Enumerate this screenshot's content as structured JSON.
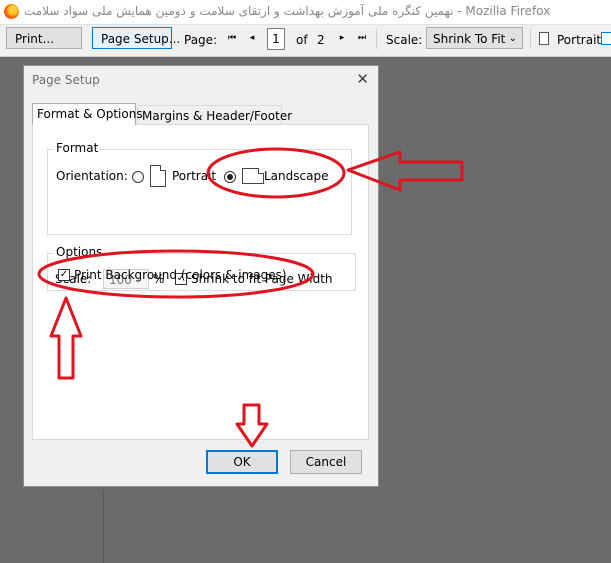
{
  "window": {
    "title": "نهمین کنگره ملی آموزش بهداشت و ارتقای سلامت و دومین همایش ملی سواد سلامت - Mozilla Firefox"
  },
  "toolbar": {
    "print_label": "Print...",
    "page_setup_label": "Page Setup...",
    "page_label": "Page:",
    "page_value": "1",
    "of_label": "of",
    "page_total": "2",
    "scale_label": "Scale:",
    "scale_value": "Shrink To Fit",
    "portrait_label": "Portrait",
    "first_page_icon": "⏮",
    "prev_page_icon": "◂",
    "next_page_icon": "▸",
    "last_page_icon": "⏭"
  },
  "dialog": {
    "title": "Page Setup",
    "tabs": [
      {
        "label": "Format & Options"
      },
      {
        "label": "Margins & Header/Footer"
      }
    ],
    "format": {
      "group_label": "Format",
      "orientation_label": "Orientation:",
      "portrait_label": "Portrait",
      "landscape_label": "Landscape",
      "selected_orientation": "Landscape",
      "scale_label": "Scale:",
      "scale_value": "100",
      "percent_label": "%",
      "shrink_label": "Shrink to fit Page Width",
      "shrink_checked": true
    },
    "options": {
      "group_label": "Options",
      "print_background_label": "Print Background (colors & images)",
      "print_background_checked": true
    },
    "ok_label": "OK",
    "cancel_label": "Cancel",
    "close_glyph": "✕"
  },
  "colors": {
    "annotation_red": "#e0141e",
    "focus_blue": "#0078d7",
    "preview_background": "#6b6b6b"
  }
}
